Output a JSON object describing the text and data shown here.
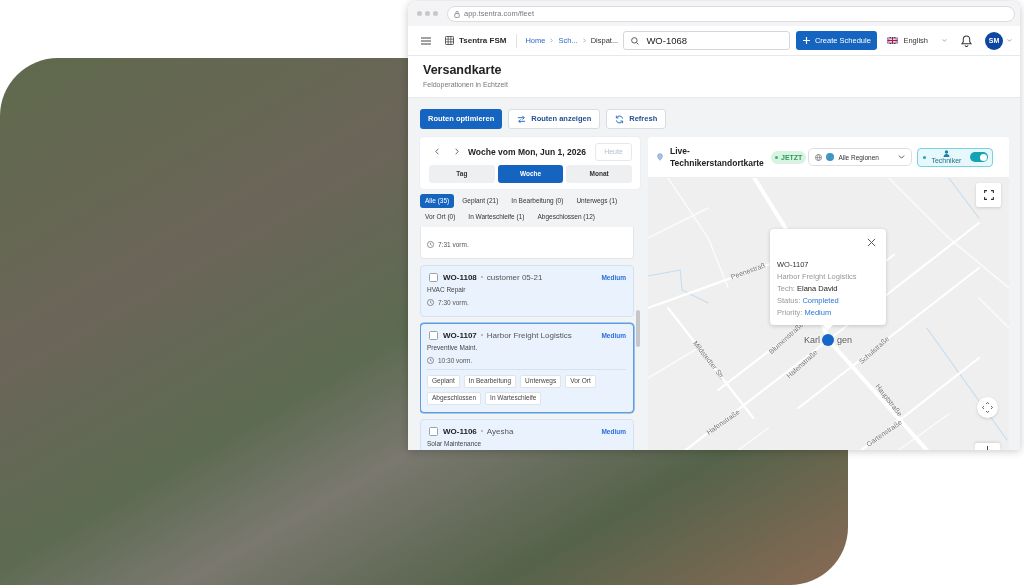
{
  "browser": {
    "url": "app.tsentra.com/fleet"
  },
  "header": {
    "brand": "Tsentra FSM",
    "breadcrumbs": [
      {
        "label": "Home",
        "current": false
      },
      {
        "label": "Sch...",
        "current": false
      },
      {
        "label": "Dispat...",
        "current": true
      }
    ],
    "search": {
      "value": "WO-1068"
    },
    "create_button": "Create Schedule",
    "language": "English",
    "avatar": "SM"
  },
  "page": {
    "title": "Versandkarte",
    "subtitle": "Feldoperationen in Echtzeit"
  },
  "actions": [
    {
      "label": "Routen optimieren",
      "kind": "primary"
    },
    {
      "label": "Routen anzeigen",
      "kind": "routes"
    },
    {
      "label": "Refresh",
      "kind": "refresh"
    }
  ],
  "calendar": {
    "title": "Woche vom Mon, Jun 1, 2026",
    "today_button": {
      "label": "Heute",
      "disabled": true
    },
    "views": [
      {
        "label": "Tag",
        "selected": false
      },
      {
        "label": "Woche",
        "selected": true
      },
      {
        "label": "Monat",
        "selected": false
      }
    ]
  },
  "filters": [
    {
      "label": "Alle (35)",
      "selected": true
    },
    {
      "label": "Geplant (21)",
      "selected": false
    },
    {
      "label": "In Bearbeitung (0)",
      "selected": false
    },
    {
      "label": "Unterwegs (1)",
      "selected": false
    },
    {
      "label": "Vor Ort (0)",
      "selected": false
    },
    {
      "label": "In Warteschleife (1)",
      "selected": false
    },
    {
      "label": "Abgeschlossen (12)",
      "selected": false
    }
  ],
  "work_orders": [
    {
      "time": "7:31 vorm.",
      "selected": false,
      "highlighted": false
    },
    {
      "id": "WO-1108",
      "customer": "customer 05-21",
      "priority": "Medium",
      "service": "HVAC Repair",
      "time": "7:30 vorm.",
      "checked": false,
      "selected": false,
      "highlighted": true
    },
    {
      "id": "WO-1107",
      "customer": "Harbor Freight Logistics",
      "priority": "Medium",
      "service": "Preventive Maint.",
      "time": "10:30 vorm.",
      "checked": false,
      "selected": true,
      "highlighted": true,
      "status_actions": [
        "Geplant",
        "In Bearbeitung",
        "Unterwegs",
        "Vor Ort",
        "Abgeschlossen",
        "In Warteschleife"
      ]
    },
    {
      "id": "WO-1106",
      "customer": "Ayesha",
      "priority": "Medium",
      "service": "Solar Maintenance",
      "checked": false,
      "selected": false,
      "highlighted": true
    }
  ],
  "map": {
    "title": "Live-Technikerstandortkarte",
    "live_badge": "JETZT",
    "region_select": "Alle Regionen",
    "tech_toggle": {
      "label": "Techniker",
      "on": true
    },
    "street_labels": [
      "Peenestraß",
      "Mildstedter Str.",
      "Blumenstraße",
      "Hafenstraße",
      "Schulstraße",
      "Hauptstraße",
      "Hafenstraße",
      "Gartenstraße"
    ],
    "town_label": {
      "before": "Karl",
      "after": "gen"
    },
    "popup": {
      "id": "WO-1107",
      "customer": "Harbor Freight Logistics",
      "details": [
        {
          "label": "Tech:",
          "value": "Elana David",
          "kind": "strong"
        },
        {
          "label": "Status:",
          "value": "Completed",
          "kind": "link"
        },
        {
          "label": "Priority:",
          "value": "Medium",
          "kind": "link"
        }
      ]
    }
  }
}
